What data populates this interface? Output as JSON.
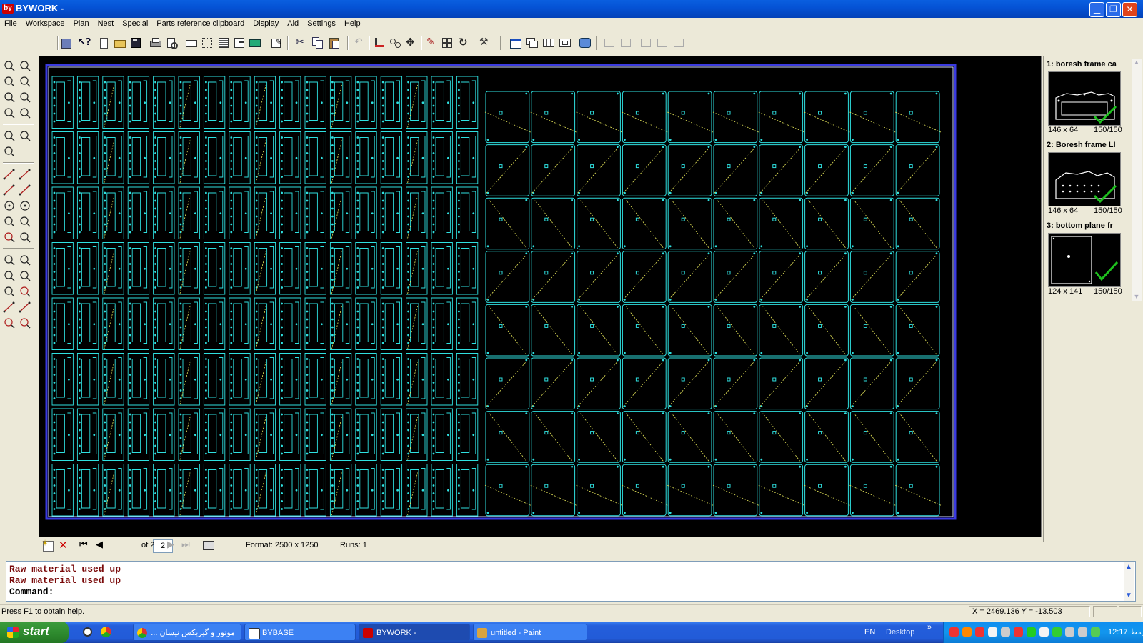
{
  "window": {
    "title": "BYWORK -",
    "logo": "by"
  },
  "menu": [
    "File",
    "Workspace",
    "Plan",
    "Nest",
    "Special",
    "Parts reference clipboard",
    "Display",
    "Aid",
    "Settings",
    "Help"
  ],
  "toolbar_icons": [
    "import-icon",
    "help-pointer-icon",
    "new-file-icon",
    "open-folder-icon",
    "save-icon",
    "print-icon",
    "print-preview-icon",
    "machine-icon",
    "grid-icon",
    "list-icon",
    "tool-icon",
    "edit-icon",
    "cut-icon",
    "copy-icon",
    "paste-icon",
    "undo-icon",
    "measure-icon",
    "move-points-icon",
    "move-icon",
    "pencil-icon",
    "array-icon",
    "rotate-icon",
    "magic-wand-icon",
    "window-icon",
    "cascade-icon",
    "tile-icon",
    "frame-icon",
    "info-icon",
    "disabled-icon-1",
    "disabled-icon-2",
    "disabled-icon-3",
    "disabled-icon-4",
    "disabled-icon-5"
  ],
  "parts": [
    {
      "title": "1: boresh frame ca",
      "size": "146 x 64",
      "count": "150/150"
    },
    {
      "title": "2: Boresh frame LI",
      "size": "146 x 64",
      "count": "150/150"
    },
    {
      "title": "3: bottom plane fr",
      "size": "124 x 141",
      "count": "150/150"
    }
  ],
  "nav": {
    "page": "2",
    "of": "of 2",
    "format": "Format: 2500 x 1250",
    "runs": "Runs: 1"
  },
  "command": {
    "lines": [
      "Raw material used up",
      "Raw material used up",
      "Command:"
    ]
  },
  "status": {
    "help": "Press F1 to obtain help.",
    "coords": "X = 2469.136   Y = -13.503"
  },
  "taskbar": {
    "start": "start",
    "tasks": [
      "موتور و گیربکس نیسان ...",
      "BYBASE",
      "BYWORK -",
      "untitled - Paint"
    ],
    "lang": "EN",
    "desktop": "Desktop",
    "clock": "12:17 ب.ظ"
  },
  "colors": {
    "sheet": "#000000",
    "part_outline": "#2fe0e0",
    "toolpath": "#e8e85a",
    "sheet_border": "#3a3ae0"
  }
}
